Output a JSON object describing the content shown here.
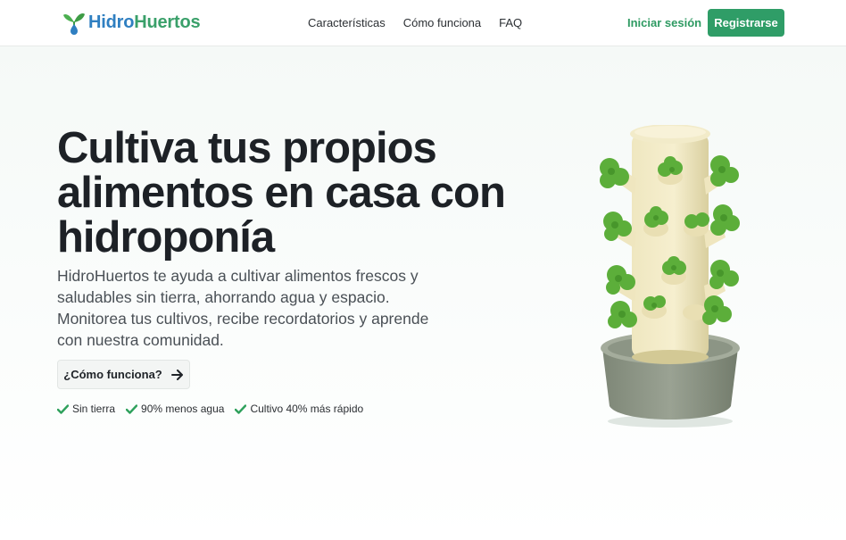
{
  "header": {
    "logo": {
      "part1": "Hidro",
      "part2": "Huertos",
      "icon": "sprout-drop-icon"
    },
    "nav": [
      "Características",
      "Cómo funciona",
      "FAQ"
    ],
    "login_label": "Iniciar sesión",
    "signup_label": "Registrarse"
  },
  "hero": {
    "title": "Cultiva tus propios alimentos en casa con hidroponía",
    "subtitle": "HidroHuertos te ayuda a cultivar alimentos frescos y saludables sin tierra, ahorrando agua y espacio. Monitorea tus cultivos, recibe recordatorios y aprende con nuestra comunidad.",
    "cta_label": "¿Cómo funciona?",
    "cta_icon": "arrow-right-icon",
    "features": [
      "Sin tierra",
      "90% menos agua",
      "Cultivo 40% más rápido"
    ],
    "feature_icon": "check-icon",
    "image": "hydroponic-tower-illustration"
  },
  "colors": {
    "brand_green": "#2f9d67",
    "brand_blue": "#2f7fc1",
    "check_green": "#2ea15c",
    "text_dark": "#1d2126"
  }
}
